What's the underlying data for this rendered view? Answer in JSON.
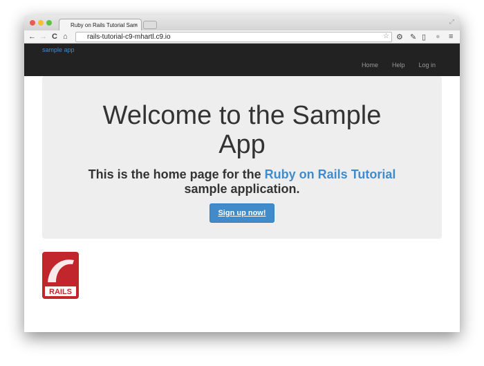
{
  "browser": {
    "tab_title": "Ruby on Rails Tutorial Sam",
    "url": "rails-tutorial-c9-mhartl.c9.io"
  },
  "navbar": {
    "brand": "sample app",
    "links": [
      "Home",
      "Help",
      "Log in"
    ]
  },
  "jumbotron": {
    "title": "Welcome to the Sample App",
    "subtitle_prefix": "This is the home page for the ",
    "subtitle_link": "Ruby on Rails Tutorial",
    "subtitle_suffix": " sample application.",
    "button": "Sign up now!"
  },
  "logo": {
    "text": "RAILS"
  },
  "colors": {
    "navbar": "#222222",
    "link": "#428bca",
    "jumbotron": "#eeeeee",
    "logo": "#c0262b"
  }
}
